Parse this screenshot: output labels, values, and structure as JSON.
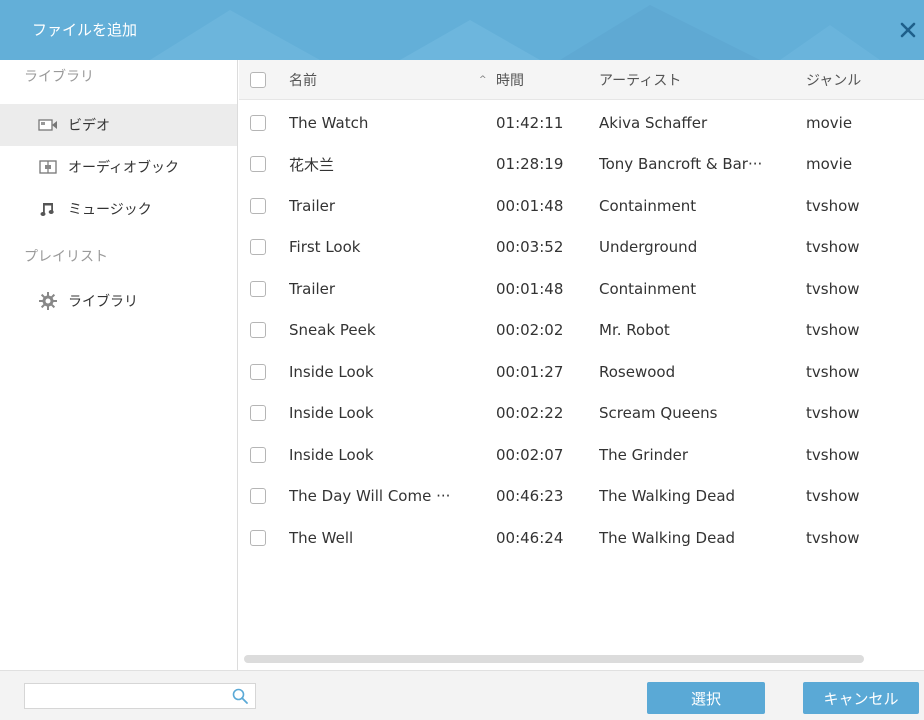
{
  "window": {
    "title": "ファイルを追加"
  },
  "sidebar": {
    "library_header": "ライブラリ",
    "items": [
      {
        "label": "ビデオ",
        "icon": "video-icon",
        "active": true
      },
      {
        "label": "オーディオブック",
        "icon": "audiobook-icon",
        "active": false
      },
      {
        "label": "ミュージック",
        "icon": "music-note-icon",
        "active": false
      }
    ],
    "playlist_header": "プレイリスト",
    "playlists": [
      {
        "label": "ライブラリ",
        "icon": "gear-icon"
      }
    ]
  },
  "table": {
    "columns": {
      "name": "名前",
      "time": "時間",
      "artist": "アーティスト",
      "genre": "ジャンル"
    },
    "sort_indicator": "^",
    "rows": [
      {
        "name": "The Watch",
        "time": "01:42:11",
        "artist": "Akiva Schaffer",
        "genre": "movie"
      },
      {
        "name": "花木兰",
        "time": "01:28:19",
        "artist": "Tony Bancroft & Bar···",
        "genre": "movie"
      },
      {
        "name": "Trailer",
        "time": "00:01:48",
        "artist": "Containment",
        "genre": "tvshow"
      },
      {
        "name": "First Look",
        "time": "00:03:52",
        "artist": "Underground",
        "genre": "tvshow"
      },
      {
        "name": "Trailer",
        "time": "00:01:48",
        "artist": "Containment",
        "genre": "tvshow"
      },
      {
        "name": "Sneak Peek",
        "time": "00:02:02",
        "artist": "Mr. Robot",
        "genre": "tvshow"
      },
      {
        "name": "Inside Look",
        "time": "00:01:27",
        "artist": "Rosewood",
        "genre": "tvshow"
      },
      {
        "name": "Inside Look",
        "time": "00:02:22",
        "artist": "Scream Queens",
        "genre": "tvshow"
      },
      {
        "name": "Inside Look",
        "time": "00:02:07",
        "artist": "The Grinder",
        "genre": "tvshow"
      },
      {
        "name": "The Day Will Come ···",
        "time": "00:46:23",
        "artist": "The Walking Dead",
        "genre": "tvshow"
      },
      {
        "name": "The Well",
        "time": "00:46:24",
        "artist": "The Walking Dead",
        "genre": "tvshow"
      }
    ]
  },
  "footer": {
    "search_value": "",
    "select_label": "選択",
    "cancel_label": "キャンセル"
  },
  "colors": {
    "accent": "#5aa9d6",
    "titlebar": "#63afd8",
    "active_item": "#ececec"
  }
}
